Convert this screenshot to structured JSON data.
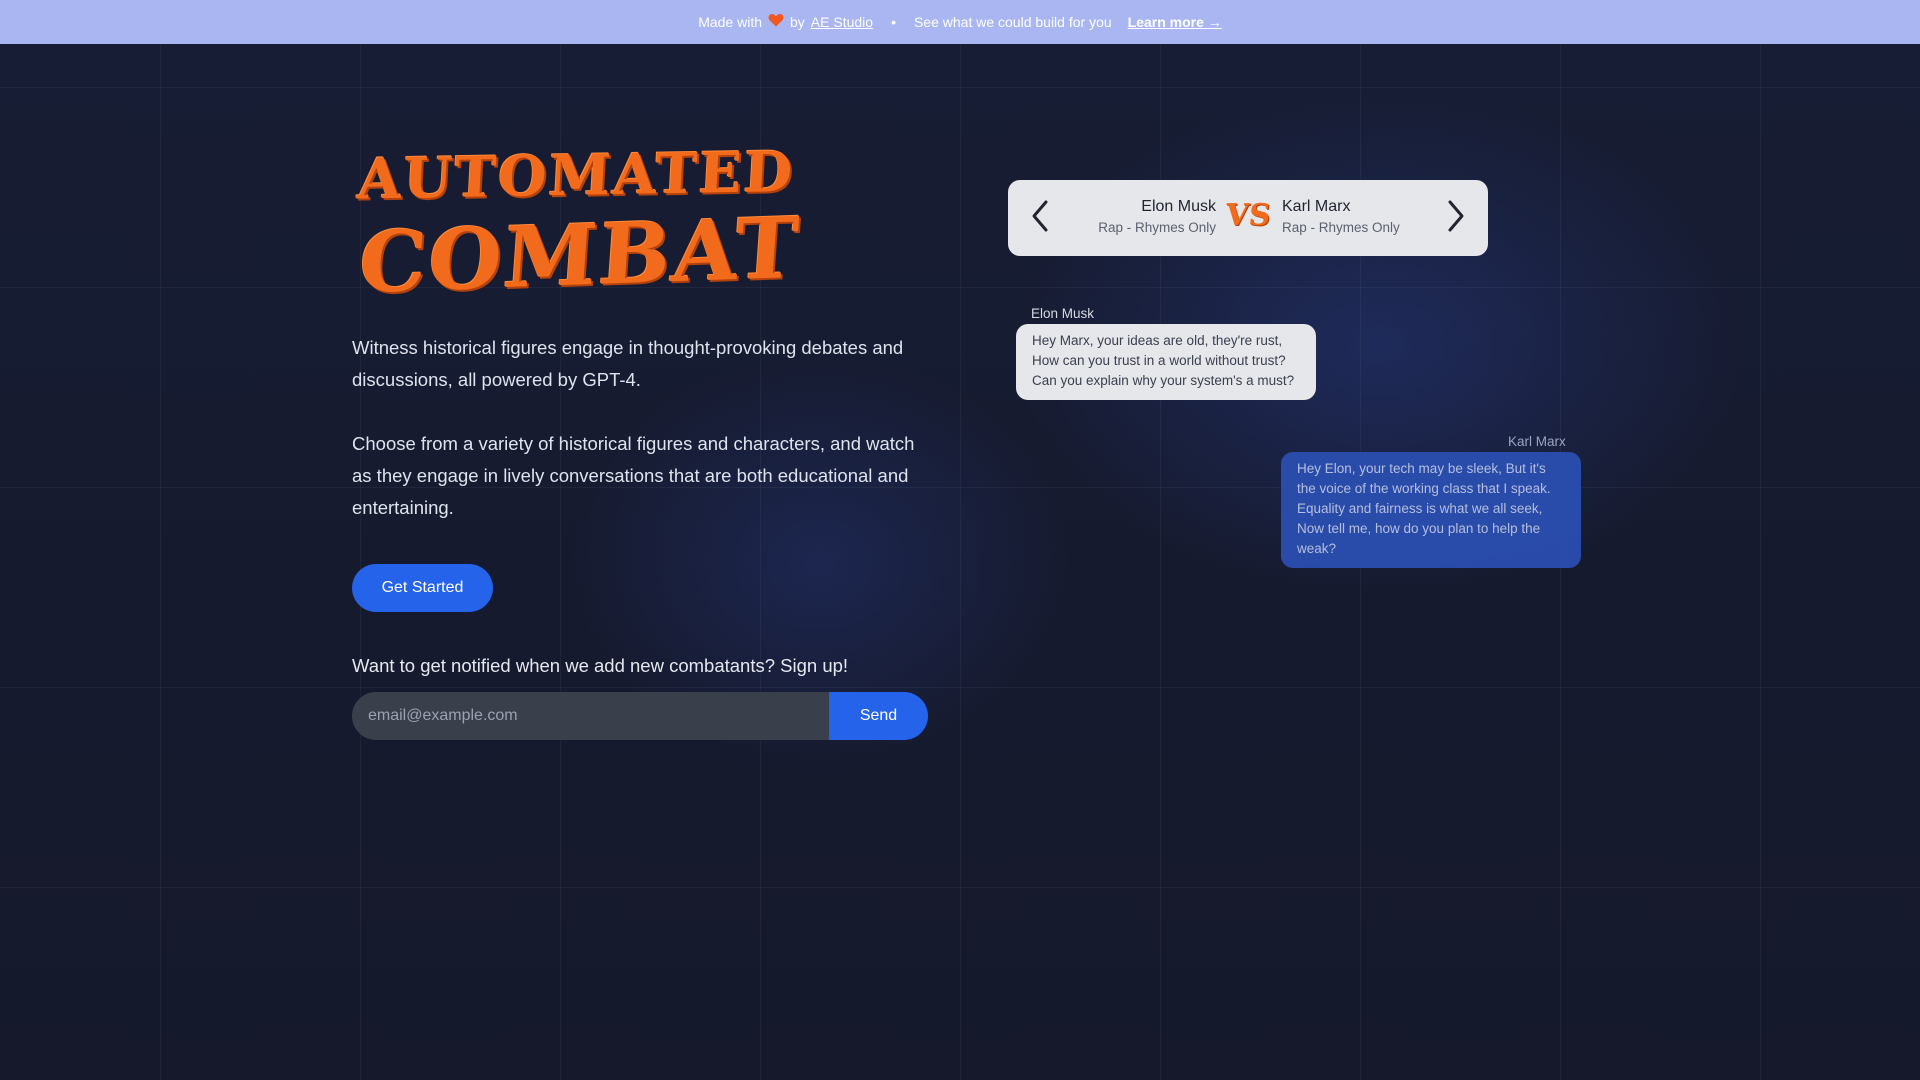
{
  "banner": {
    "made_with": "Made with",
    "by": "by",
    "studio_link": "AE Studio",
    "separator": "•",
    "pitch": "See what we could build for you",
    "learn_more": "Learn more →"
  },
  "logo": {
    "line1": "AUTOMATED",
    "line2": "COMBAT"
  },
  "intro": {
    "paragraph1": "Witness historical figures engage in thought-provoking debates and discussions, all powered by GPT-4.",
    "paragraph2": "Choose from a variety of historical figures and characters, and watch as they engage in lively conversations that are both educational and entertaining."
  },
  "cta": {
    "get_started": "Get Started"
  },
  "signup": {
    "label": "Want to get notified when we add new combatants? Sign up!",
    "placeholder": "email@example.com",
    "value": "",
    "send": "Send"
  },
  "matchup": {
    "left": {
      "name": "Elon Musk",
      "mode": "Rap - Rhymes Only"
    },
    "vs": "VS",
    "right": {
      "name": "Karl Marx",
      "mode": "Rap - Rhymes Only"
    }
  },
  "chat": [
    {
      "speaker": "Elon Musk",
      "lines": [
        "Hey Marx, your ideas are old, they're rust,",
        "How can you trust in a world without trust?",
        "Can you explain why your system's a must?"
      ]
    },
    {
      "speaker": "Karl Marx",
      "lines": [
        "Hey Elon, your tech may be sleek, But it's",
        "the voice of the working class that I speak.",
        "Equality and fairness is what we all seek,",
        "Now tell me, how do you plan to help the",
        "weak?"
      ]
    }
  ],
  "colors": {
    "banner_bg": "#a9b6f1",
    "page_bg": "#161b30",
    "accent_blue": "#2563eb",
    "logo_orange": "#f26a1b",
    "heart": "#f3561f"
  },
  "icons": [
    "heart-icon",
    "chevron-left-icon",
    "chevron-right-icon"
  ]
}
